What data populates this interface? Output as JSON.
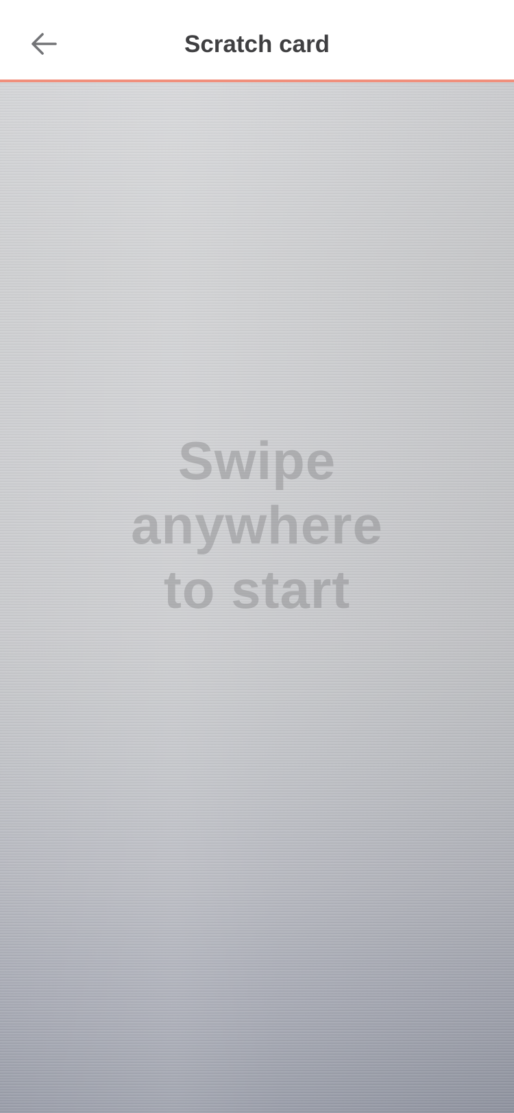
{
  "header": {
    "title": "Scratch card",
    "back_icon": "arrow-left-icon",
    "accent_color": "#f08f7c"
  },
  "scratch_card": {
    "prompt": "Swipe anywhere to start",
    "surface": "brushed-metal"
  }
}
